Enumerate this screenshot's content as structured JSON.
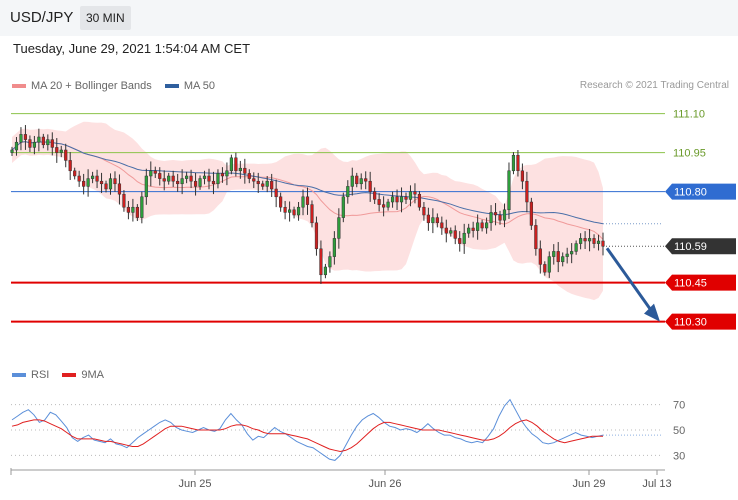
{
  "header": {
    "pair": "USD/JPY",
    "timeframe": "30 MIN"
  },
  "datetime": "Tuesday, June 29, 2021 1:54:04 AM CET",
  "copyright": "Research © 2021 Trading Central",
  "legend": {
    "main": [
      {
        "label": "MA 20 + Bollinger Bands",
        "color": "#f08c8c"
      },
      {
        "label": "MA 50",
        "color": "#2f5f9e"
      }
    ],
    "rsi": [
      {
        "label": "RSI",
        "color": "#5b8fd9"
      },
      {
        "label": "9MA",
        "color": "#e02020"
      }
    ]
  },
  "colors": {
    "up": "#2e9e3c",
    "down": "#cc1f1f",
    "support": "#e00000",
    "pivot": "#2f6cd1",
    "resistance": "#8bc34a",
    "last": "#333333",
    "arrow": "#2c5a99"
  },
  "chart_data": [
    {
      "type": "candlestick",
      "ylim": [
        110.16,
        111.16
      ],
      "x_ticks": [
        "Jun 25",
        "Jun 26",
        "Jun 29",
        "Jul 13"
      ],
      "levels": [
        {
          "value": 111.1,
          "label": "111.10",
          "kind": "resistance"
        },
        {
          "value": 110.95,
          "label": "110.95",
          "kind": "resistance"
        },
        {
          "value": 110.8,
          "label": "110.80",
          "kind": "pivot"
        },
        {
          "value": 110.59,
          "label": "110.59",
          "kind": "last"
        },
        {
          "value": 110.45,
          "label": "110.45",
          "kind": "support"
        },
        {
          "value": 110.3,
          "label": "110.30",
          "kind": "support"
        }
      ],
      "close": [
        110.96,
        110.99,
        111.02,
        111.0,
        110.97,
        110.99,
        111.01,
        110.98,
        111.0,
        110.97,
        110.95,
        110.96,
        110.92,
        110.88,
        110.86,
        110.84,
        110.82,
        110.85,
        110.86,
        110.84,
        110.83,
        110.81,
        110.85,
        110.83,
        110.79,
        110.74,
        110.72,
        110.74,
        110.7,
        110.78,
        110.86,
        110.88,
        110.87,
        110.85,
        110.84,
        110.86,
        110.84,
        110.83,
        110.85,
        110.86,
        110.84,
        110.82,
        110.85,
        110.86,
        110.84,
        110.83,
        110.87,
        110.86,
        110.88,
        110.93,
        110.88,
        110.89,
        110.87,
        110.85,
        110.84,
        110.83,
        110.82,
        110.84,
        110.81,
        110.78,
        110.74,
        110.72,
        110.73,
        110.71,
        110.74,
        110.78,
        110.75,
        110.68,
        110.58,
        110.48,
        110.51,
        110.55,
        110.62,
        110.7,
        110.78,
        110.82,
        110.86,
        110.83,
        110.85,
        110.84,
        110.8,
        110.77,
        110.75,
        110.74,
        110.76,
        110.78,
        110.76,
        110.78,
        110.77,
        110.8,
        110.79,
        110.74,
        110.71,
        110.68,
        110.7,
        110.68,
        110.66,
        110.64,
        110.65,
        110.62,
        110.6,
        110.64,
        110.66,
        110.65,
        110.68,
        110.66,
        110.68,
        110.72,
        110.71,
        110.69,
        110.73,
        110.88,
        110.94,
        110.88,
        110.84,
        110.76,
        110.67,
        110.58,
        110.52,
        110.49,
        110.55,
        110.57,
        110.53,
        110.55,
        110.56,
        110.57,
        110.6,
        110.62,
        110.61,
        110.62,
        110.6,
        110.61,
        110.59
      ],
      "rsi": {
        "ylim": [
          20,
          80
        ],
        "levels": [
          70,
          50,
          30
        ],
        "rsi": [
          58,
          61,
          64,
          66,
          62,
          56,
          58,
          64,
          62,
          57,
          52,
          44,
          41,
          44,
          46,
          42,
          41,
          40,
          43,
          39,
          38,
          36,
          40,
          44,
          47,
          50,
          53,
          56,
          58,
          56,
          52,
          50,
          49,
          48,
          50,
          52,
          50,
          49,
          51,
          58,
          63,
          58,
          54,
          47,
          42,
          45,
          44,
          48,
          52,
          49,
          47,
          44,
          41,
          39,
          37,
          36,
          33,
          30,
          27,
          26,
          30,
          38,
          46,
          53,
          58,
          61,
          63,
          60,
          56,
          53,
          52,
          50,
          51,
          50,
          48,
          51,
          55,
          51,
          48,
          46,
          46,
          44,
          43,
          41,
          40,
          41,
          40,
          45,
          51,
          61,
          69,
          74,
          66,
          58,
          52,
          47,
          44,
          40,
          39,
          40,
          42,
          44,
          46,
          48,
          46,
          45,
          44,
          45,
          46
        ],
        "ma": [
          53,
          54,
          56,
          57,
          58,
          58,
          57,
          55,
          53,
          51,
          48,
          45,
          43,
          43,
          43,
          43,
          42,
          41,
          41,
          40,
          39,
          38,
          37,
          37,
          39,
          42,
          45,
          48,
          51,
          53,
          53,
          53,
          52,
          51,
          50,
          50,
          50,
          50,
          50,
          51,
          53,
          54,
          54,
          53,
          51,
          50,
          48,
          47,
          47,
          47,
          47,
          46,
          45,
          44,
          43,
          41,
          39,
          37,
          35,
          34,
          33,
          34,
          36,
          39,
          43,
          47,
          51,
          54,
          56,
          56,
          55,
          54,
          53,
          52,
          51,
          50,
          50,
          50,
          50,
          49,
          48,
          47,
          46,
          45,
          44,
          43,
          42,
          42,
          43,
          45,
          48,
          52,
          55,
          57,
          58,
          56,
          53,
          49,
          46,
          43,
          41,
          40,
          41,
          42,
          43,
          44,
          45,
          45,
          45
        ]
      }
    }
  ]
}
